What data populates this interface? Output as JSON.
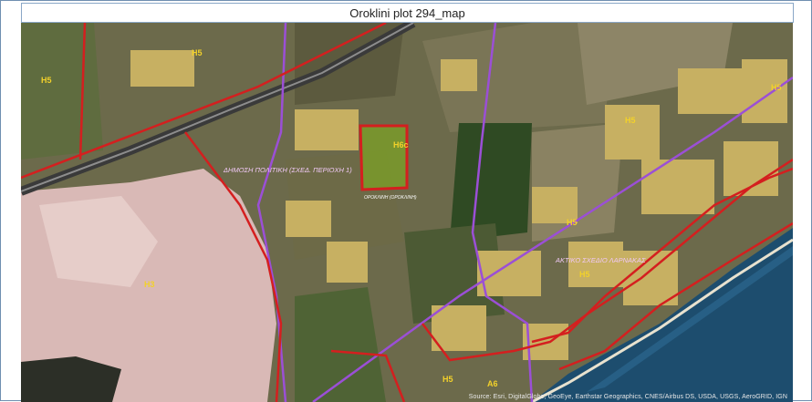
{
  "window": {
    "title": "Oroklini plot 294_map"
  },
  "map": {
    "highlighted_plot_label": "H6c",
    "zone_labels": [
      "H5",
      "H5",
      "H5",
      "H5",
      "H3",
      "H5",
      "H5",
      "H5",
      "A6"
    ],
    "area_labels": [
      "ΔΗΜΟΣΗ ΠΟΛΙΤΙΚΗ (ΣΧΕΔ. ΠΕΡΙΟΧΗ 1)",
      "ΑΚΤΙΚΟ ΣΧΕΔΙΟ ΛΑΡΝΑΚΑΣ",
      "ΟΡΟΚΛΙΝΗ (ΟΡΟΚΛΙΝΗ)"
    ],
    "attribution": "Source: Esri, DigitalGlobe, GeoEye, Earthstar Geographics, CNES/Airbus DS, USDA, USGS, AeroGRID, IGN"
  },
  "colors": {
    "boundary_red": "#d41f1f",
    "boundary_purple": "#9b4fd6",
    "plot_fill": "#7a9a2a",
    "salt_lake": "#e2c4c4",
    "sea": "#1d4d6e",
    "label_yellow": "#f2d12a"
  }
}
